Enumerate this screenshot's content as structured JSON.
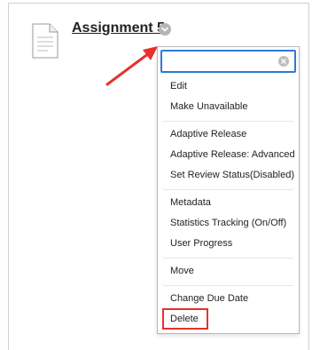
{
  "item": {
    "title": "Assignment 5"
  },
  "menu": {
    "search_value": "",
    "items": [
      {
        "label": "Edit"
      },
      {
        "label": "Make Unavailable"
      },
      {
        "label": "Adaptive Release"
      },
      {
        "label": "Adaptive Release: Advanced"
      },
      {
        "label": "Set Review Status(Disabled)"
      },
      {
        "label": "Metadata"
      },
      {
        "label": "Statistics Tracking (On/Off)"
      },
      {
        "label": "User Progress"
      },
      {
        "label": "Move"
      },
      {
        "label": "Change Due Date"
      },
      {
        "label": "Delete"
      }
    ]
  },
  "colors": {
    "annotation_red": "#e8302c",
    "focus_blue": "#2c7bd3"
  },
  "icons": {
    "item_icon": "document-icon",
    "options_button": "chevron-down-icon",
    "clear_button": "clear-icon"
  }
}
